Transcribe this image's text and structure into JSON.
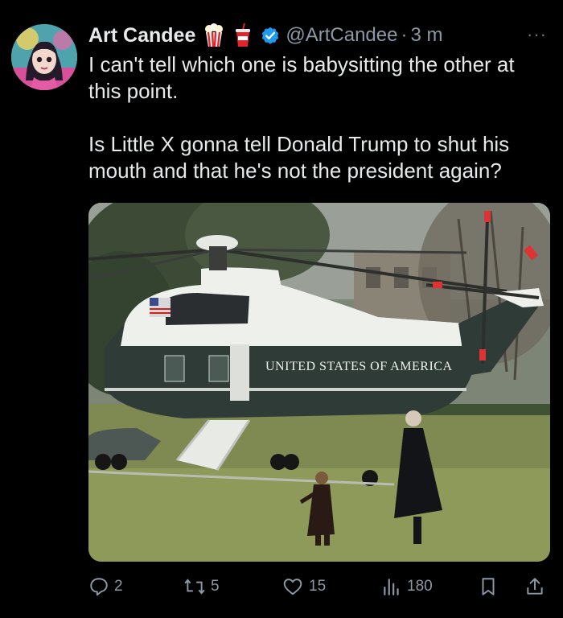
{
  "author": {
    "display_name": "Art Candee",
    "handle": "@ArtCandee",
    "separator": "·",
    "time": "3 m",
    "emojis": [
      "popcorn-icon",
      "soda-cup-icon"
    ],
    "verified_color": "#1d9bf0"
  },
  "more_label": "···",
  "body": {
    "paragraph1": "I can't tell which one is babysitting the other at this point.",
    "paragraph2": "Is Little X gonna tell Donald Trump to shut his mouth and that he's not the president again?"
  },
  "media": {
    "helicopter_text": "UNITED STATES OF AMERICA"
  },
  "actions": {
    "replies": "2",
    "reposts": "5",
    "likes": "15",
    "views": "180"
  },
  "colors": {
    "background": "#000000",
    "text": "#e7e9ea",
    "secondary": "#8b98a5"
  }
}
